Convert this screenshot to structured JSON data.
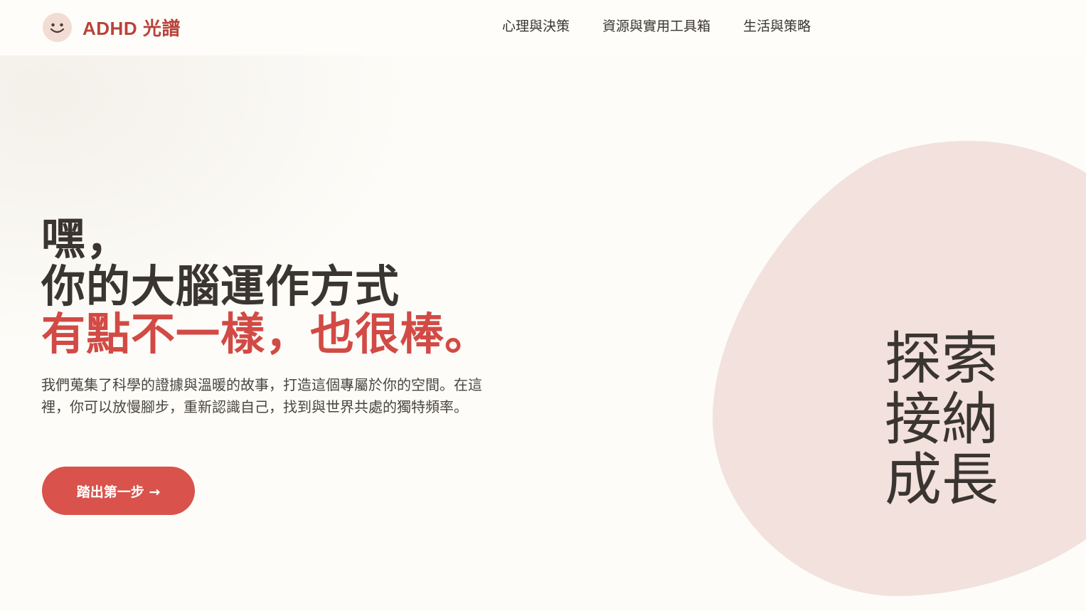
{
  "header": {
    "logo_text": "ADHD 光譜",
    "nav": [
      {
        "label": "心理與決策"
      },
      {
        "label": "資源與實用工具箱"
      },
      {
        "label": "生活與策略"
      }
    ]
  },
  "hero": {
    "title_line1": "嘿，",
    "title_line2": "你的大腦運作方式",
    "title_line3": "有點不一樣，也很棒。",
    "description": "我們蒐集了科學的證據與溫暖的故事，打造這個專屬於你的空間。在這裡，你可以放慢腳步，重新認識自己，找到與世界共處的獨特頻率。",
    "cta_label": "踏出第一步 →"
  },
  "feature_words": [
    "探索",
    "接納",
    "成長"
  ],
  "colors": {
    "brand": "#b9433a",
    "accent": "#d24a45",
    "button": "#d9524c",
    "blob": "#f2e1dc",
    "text": "#3a3530",
    "background": "#fdfcf8"
  },
  "icons": {
    "logo": "smiley-face-icon"
  }
}
